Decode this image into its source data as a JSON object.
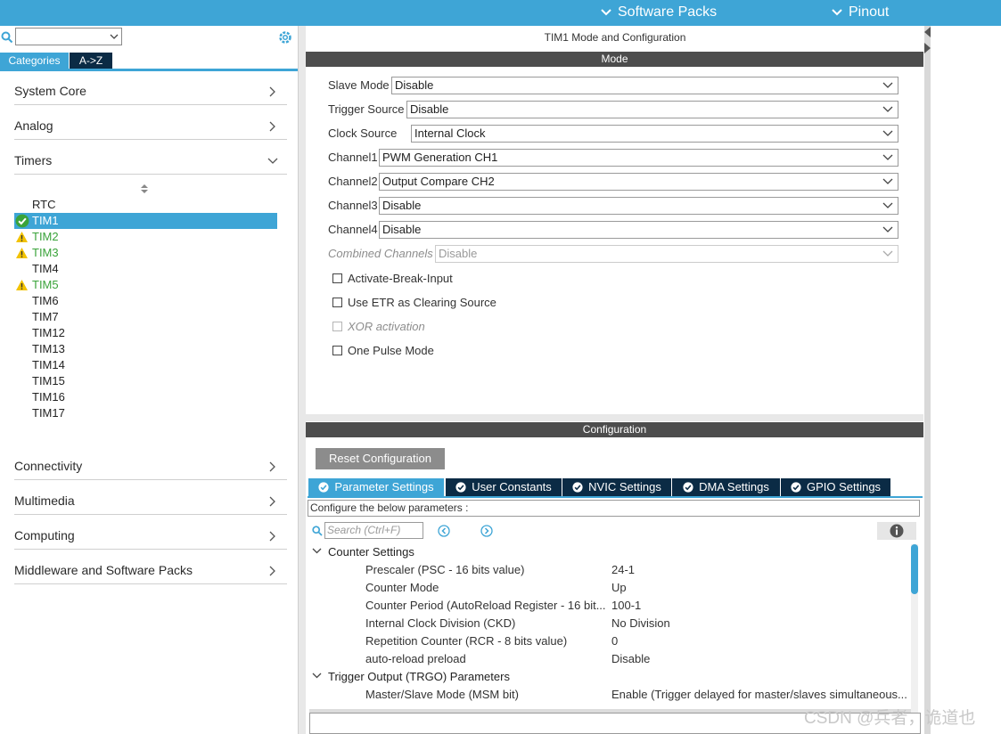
{
  "topbar": {
    "software_packs": "Software Packs",
    "pinout": "Pinout"
  },
  "left": {
    "tabs": [
      "Categories",
      "A->Z"
    ],
    "categories_top": [
      "System Core",
      "Analog",
      "Timers"
    ],
    "timers": [
      {
        "name": "RTC",
        "status": "none"
      },
      {
        "name": "TIM1",
        "status": "ok"
      },
      {
        "name": "TIM2",
        "status": "warning"
      },
      {
        "name": "TIM3",
        "status": "warning"
      },
      {
        "name": "TIM4",
        "status": "none"
      },
      {
        "name": "TIM5",
        "status": "warning"
      },
      {
        "name": "TIM6",
        "status": "none"
      },
      {
        "name": "TIM7",
        "status": "none"
      },
      {
        "name": "TIM12",
        "status": "none"
      },
      {
        "name": "TIM13",
        "status": "none"
      },
      {
        "name": "TIM14",
        "status": "none"
      },
      {
        "name": "TIM15",
        "status": "none"
      },
      {
        "name": "TIM16",
        "status": "none"
      },
      {
        "name": "TIM17",
        "status": "none"
      }
    ],
    "categories_bottom": [
      "Connectivity",
      "Multimedia",
      "Computing",
      "Middleware and Software Packs"
    ]
  },
  "mode": {
    "title": "TIM1 Mode and Configuration",
    "header": "Mode",
    "rows": [
      {
        "label": "Slave Mode",
        "value": "Disable"
      },
      {
        "label": "Trigger Source",
        "value": "Disable"
      },
      {
        "label": "Clock Source",
        "value": "Internal Clock"
      },
      {
        "label": "Channel1",
        "value": "PWM Generation CH1"
      },
      {
        "label": "Channel2",
        "value": "Output Compare CH2"
      },
      {
        "label": "Channel3",
        "value": "Disable"
      },
      {
        "label": "Channel4",
        "value": "Disable"
      },
      {
        "label": "Combined Channels",
        "value": "Disable"
      }
    ],
    "checkboxes": [
      {
        "label": "Activate-Break-Input",
        "disabled": false
      },
      {
        "label": "Use ETR as Clearing Source",
        "disabled": false
      },
      {
        "label": "XOR activation",
        "disabled": true
      },
      {
        "label": "One Pulse Mode",
        "disabled": false
      }
    ]
  },
  "config": {
    "header": "Configuration",
    "reset": "Reset Configuration",
    "tabs": [
      "Parameter Settings",
      "User Constants",
      "NVIC Settings",
      "DMA Settings",
      "GPIO Settings"
    ],
    "desc": "Configure the below parameters :",
    "search_placeholder": "Search (Ctrl+F)",
    "groups": [
      {
        "title": "Counter Settings",
        "params": [
          {
            "name": "Prescaler (PSC - 16 bits value)",
            "value": "24-1"
          },
          {
            "name": "Counter Mode",
            "value": "Up"
          },
          {
            "name": "Counter Period (AutoReload Register - 16 bit...",
            "value": "100-1"
          },
          {
            "name": "Internal Clock Division (CKD)",
            "value": "No Division"
          },
          {
            "name": "Repetition Counter (RCR - 8 bits value)",
            "value": "0"
          },
          {
            "name": "auto-reload preload",
            "value": "Disable"
          }
        ]
      },
      {
        "title": "Trigger Output (TRGO) Parameters",
        "params": [
          {
            "name": "Master/Slave Mode (MSM bit)",
            "value": "Enable (Trigger delayed for master/slaves simultaneous..."
          }
        ]
      }
    ]
  },
  "watermark": "CSDN @兵者，诡道也",
  "colors": {
    "accent": "#3ea5d6",
    "dark_tab": "#0b2b45",
    "warning": "#f2c200",
    "ok_green": "#3aa33a"
  }
}
